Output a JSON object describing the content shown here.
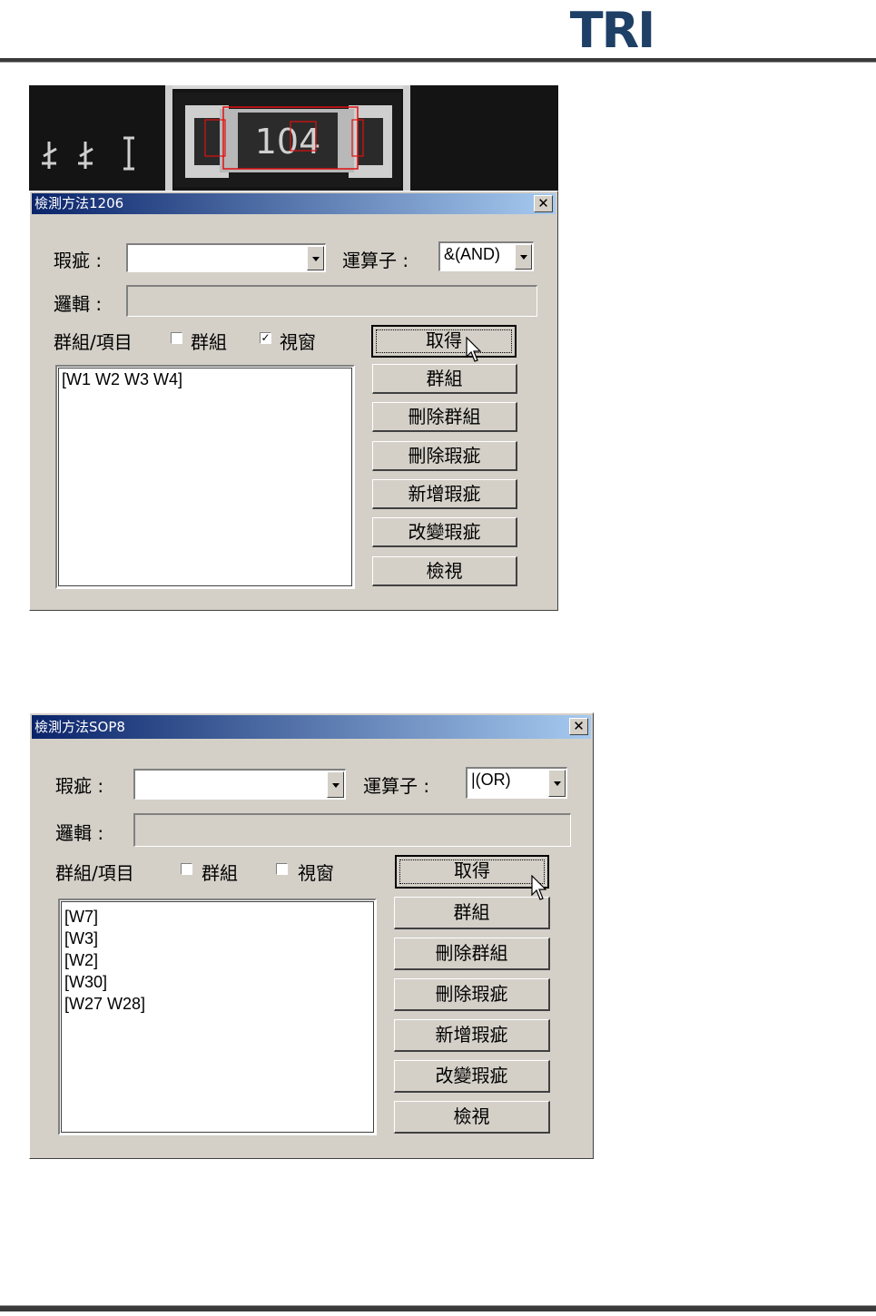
{
  "header": {
    "logo_text": "TRI"
  },
  "camera": {
    "chip_marking": "104"
  },
  "dialog1": {
    "title": "檢測方法1206",
    "close_glyph": "✕",
    "defect_label": "瑕疵 :",
    "defect_value": "",
    "operator_label": "運算子 :",
    "operator_value": "&(AND)",
    "logic_label": "邏輯 :",
    "logic_value": "",
    "group_item_label": "群組/項目",
    "group_checkbox_label": "群組",
    "group_checked": false,
    "window_checkbox_label": "視窗",
    "window_checked": true,
    "list_items": [
      "[W1 W2 W3 W4]"
    ],
    "buttons": {
      "get": "取得",
      "group": "群組",
      "delete_group": "刪除群組",
      "delete_defect": "刪除瑕疵",
      "add_defect": "新增瑕疵",
      "change_defect": "改變瑕疵",
      "view": "檢視"
    }
  },
  "dialog2": {
    "title": "檢測方法SOP8",
    "close_glyph": "✕",
    "defect_label": "瑕疵 :",
    "defect_value": "",
    "operator_label": "運算子 :",
    "operator_value": "|(OR)",
    "logic_label": "邏輯 :",
    "logic_value": "",
    "group_item_label": "群組/項目",
    "group_checkbox_label": "群組",
    "group_checked": false,
    "window_checkbox_label": "視窗",
    "window_checked": false,
    "list_items": [
      "[W7]",
      "[W3]",
      "[W2]",
      "[W30]",
      "[W27 W28]"
    ],
    "buttons": {
      "get": "取得",
      "group": "群組",
      "delete_group": "刪除群組",
      "delete_defect": "刪除瑕疵",
      "add_defect": "新增瑕疵",
      "change_defect": "改變瑕疵",
      "view": "檢視"
    }
  },
  "colors": {
    "titlebar_start": "#0a246a",
    "titlebar_end": "#a6caf0",
    "dialog_face": "#d4d0c8",
    "rule": "#3a3a3a",
    "logo": "#1e3f66"
  }
}
